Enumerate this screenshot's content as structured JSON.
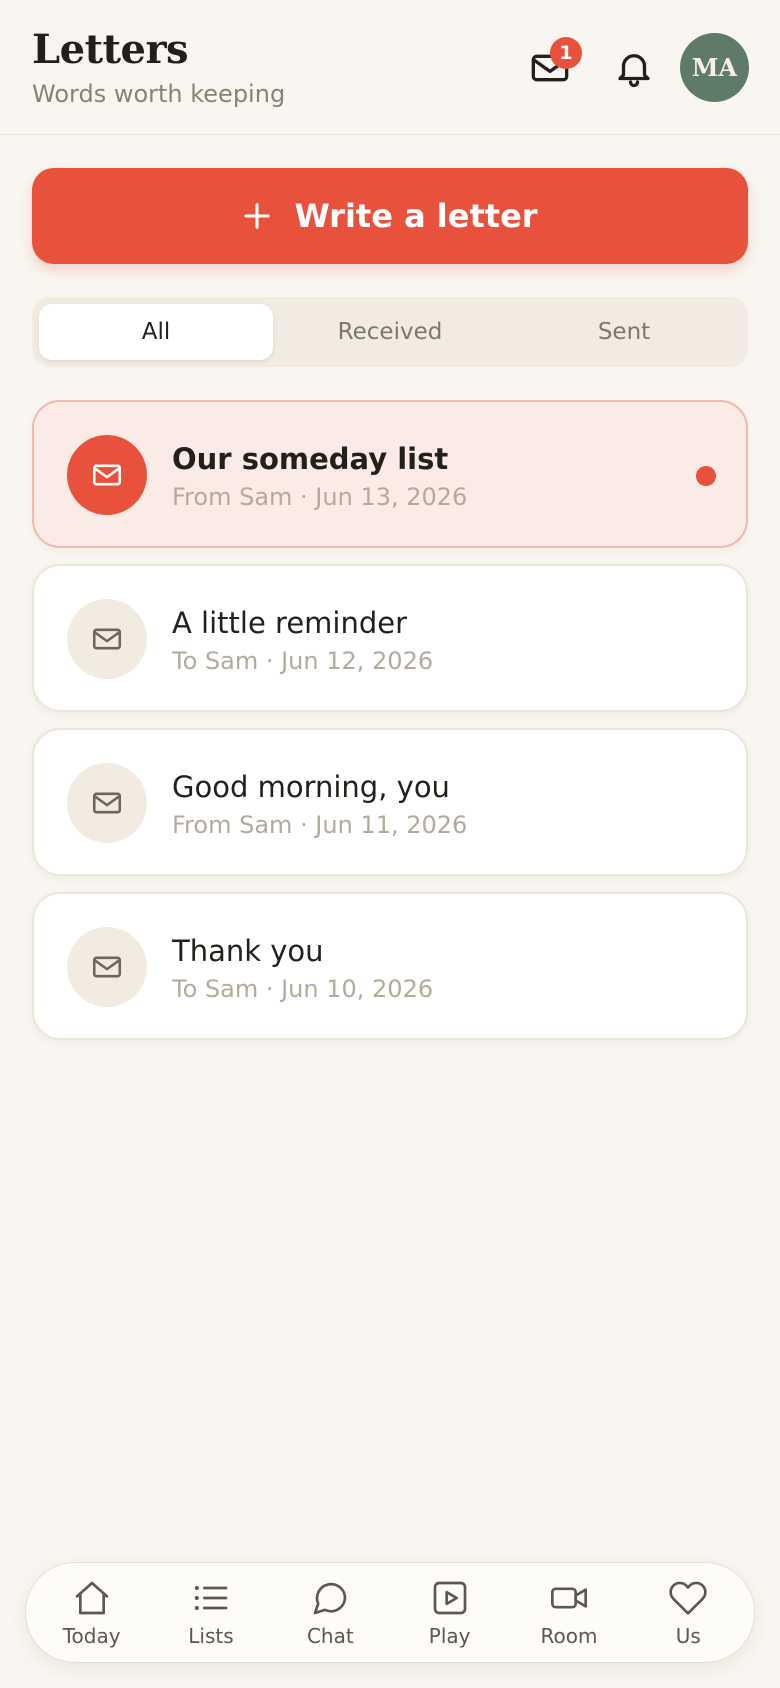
{
  "header": {
    "title": "Letters",
    "subtitle": "Words worth keeping",
    "mail_badge": "1",
    "avatar_initials": "MA"
  },
  "write_button": {
    "label": "Write a letter"
  },
  "tabs": [
    {
      "label": "All",
      "active": true
    },
    {
      "label": "Received",
      "active": false
    },
    {
      "label": "Sent",
      "active": false
    }
  ],
  "letters": [
    {
      "title": "Our someday list",
      "meta": "From Sam · Jun 13, 2026",
      "unread": true,
      "icon": "envelope-icon"
    },
    {
      "title": "A little reminder",
      "meta": "To Sam · Jun 12, 2026",
      "unread": false,
      "icon": "envelope-icon"
    },
    {
      "title": "Good morning, you",
      "meta": "From Sam · Jun 11, 2026",
      "unread": false,
      "icon": "envelope-icon"
    },
    {
      "title": "Thank you",
      "meta": "To Sam · Jun 10, 2026",
      "unread": false,
      "icon": "envelope-icon"
    }
  ],
  "bottom_nav": [
    {
      "label": "Today",
      "icon": "home-icon"
    },
    {
      "label": "Lists",
      "icon": "list-icon"
    },
    {
      "label": "Chat",
      "icon": "chat-bubble-icon"
    },
    {
      "label": "Play",
      "icon": "play-icon"
    },
    {
      "label": "Room",
      "icon": "video-icon"
    },
    {
      "label": "Us",
      "icon": "heart-icon"
    }
  ],
  "colors": {
    "accent": "#e8513b",
    "background": "#f9f6f1",
    "avatar_bg": "#5f7a66",
    "unread_card_bg": "#fbebe6"
  }
}
